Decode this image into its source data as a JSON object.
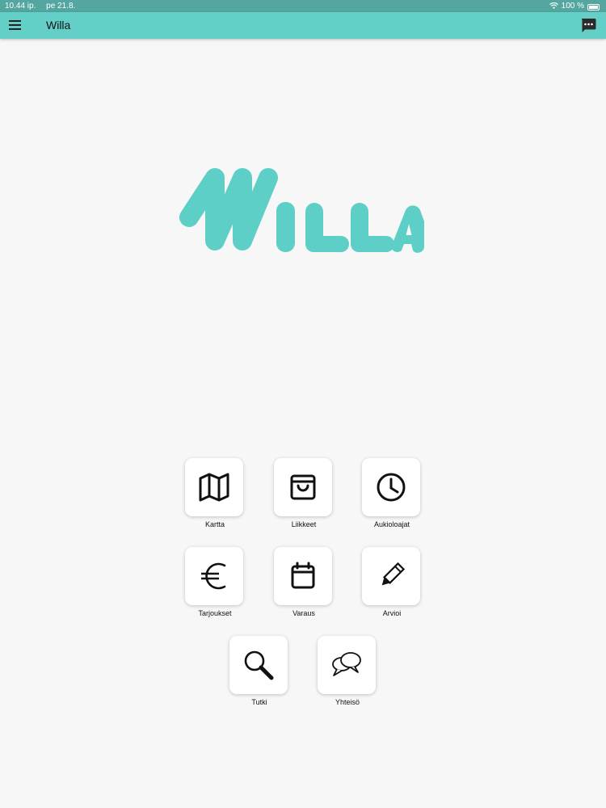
{
  "status_bar": {
    "time": "10.44 ip.",
    "date": "pe 21.8.",
    "battery": "100 %"
  },
  "app_bar": {
    "title": "Willa",
    "menu_icon": "hamburger-menu-icon",
    "chat_icon": "chat-bubble-icon"
  },
  "logo": {
    "text": "WILLA",
    "color": "#5ecfc7"
  },
  "colors": {
    "app_bar": "#64cfc7",
    "status_bar": "#54a6a0",
    "background": "#f7f7f7"
  },
  "menu": [
    {
      "label": "Kartta",
      "icon": "map-icon"
    },
    {
      "label": "Liikkeet",
      "icon": "shopping-bag-icon"
    },
    {
      "label": "Aukioloajat",
      "icon": "clock-icon"
    },
    {
      "label": "Tarjoukset",
      "icon": "euro-icon"
    },
    {
      "label": "Varaus",
      "icon": "calendar-icon"
    },
    {
      "label": "Arvioi",
      "icon": "pencil-icon"
    },
    {
      "label": "Tutki",
      "icon": "search-icon"
    },
    {
      "label": "Yhteisö",
      "icon": "speech-bubbles-icon"
    }
  ]
}
